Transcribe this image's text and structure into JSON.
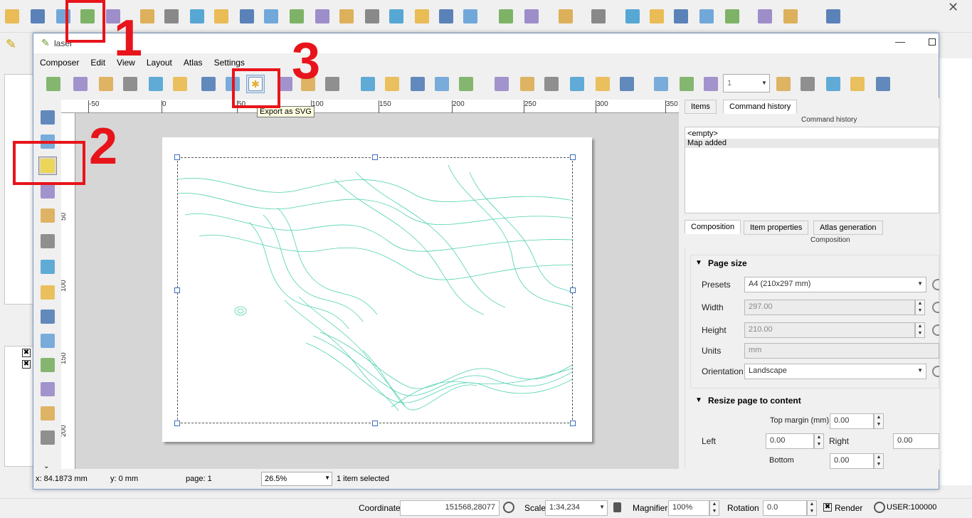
{
  "main_toolbar": {
    "icons": [
      "open-project-icon",
      "save-project-icon",
      "save-as-icon",
      "new-print-composer-icon",
      "composer-manager-icon",
      "pan-to-selection-icon",
      "pan-icon",
      "pan-move-icon",
      "zoom-in-icon",
      "zoom-out-icon",
      "zoom-native-icon",
      "zoom-full-icon",
      "zoom-to-selection-icon",
      "zoom-to-layer-icon",
      "zoom-last-icon",
      "zoom-next-icon",
      "new-bookmark-icon",
      "show-bookmarks-icon",
      "refresh-icon",
      "identify-icon",
      "action-icon",
      "select-features-icon",
      "select-by-expression-icon",
      "deselect-icon",
      "attribute-table-icon",
      "field-calculator-icon",
      "statistics-icon",
      "measure-icon",
      "map-tips-icon",
      "text-annotation-icon",
      "help-icon"
    ]
  },
  "annotations": {
    "one": "1",
    "two": "2",
    "three": "3"
  },
  "composer": {
    "title": "laser",
    "menu": [
      "Composer",
      "Edit",
      "View",
      "Layout",
      "Atlas",
      "Settings"
    ],
    "tooltip": "Export as SVG",
    "page_number": "1",
    "ruler_h": [
      "-50",
      "0",
      "50",
      "100",
      "150",
      "200",
      "250",
      "300",
      "350"
    ],
    "ruler_v": [
      "50",
      "100",
      "150",
      "200"
    ],
    "left_tools": [
      "pan-hand-icon",
      "zoom-tool-icon",
      "select-move-item-icon",
      "move-content-icon",
      "edit-nodes-icon",
      "add-map-icon",
      "add-image-icon",
      "add-label-icon",
      "add-legend-icon",
      "add-scalebar-icon",
      "add-shape-icon",
      "add-polygon-icon",
      "add-polyline-icon",
      "add-attribute-table-icon",
      "more-tools-icon"
    ],
    "status": {
      "x": "x: 84.1873 mm",
      "y": "y: 0 mm",
      "page": "page: 1",
      "zoom": "26.5%",
      "selection": "1 item selected"
    }
  },
  "right_panel": {
    "tabs_top": [
      "Items",
      "Command history"
    ],
    "active_top": "Command history",
    "history_title": "Command history",
    "history_items": [
      "<empty>",
      "Map added"
    ],
    "tabs_bottom": [
      "Composition",
      "Item properties",
      "Atlas generation"
    ],
    "composition_title": "Composition",
    "page_size_header": "Page size",
    "presets_label": "Presets",
    "presets_value": "A4 (210x297 mm)",
    "width_label": "Width",
    "width_value": "297.00",
    "height_label": "Height",
    "height_value": "210.00",
    "units_label": "Units",
    "units_value": "mm",
    "orientation_label": "Orientation",
    "orientation_value": "Landscape",
    "resize_header": "Resize page to content",
    "top_margin_label": "Top margin (mm)",
    "top_margin_value": "0.00",
    "left_label": "Left",
    "left_value": "0.00",
    "right_label": "Right",
    "right_value": "0.00",
    "bottom_label": "Bottom",
    "bottom_value": "0.00"
  },
  "status_bar": {
    "coordinate_label": "Coordinate",
    "coordinate_value": "151568,28077",
    "scale_label": "Scale",
    "scale_value": "1:34,234",
    "magnifier_label": "Magnifier",
    "magnifier_value": "100%",
    "rotation_label": "Rotation",
    "rotation_value": "0.0",
    "render_label": "Render",
    "crs_label": "USER:100000"
  },
  "colors": {
    "accent": "#e8141b",
    "contour": "#4fd1b0"
  }
}
